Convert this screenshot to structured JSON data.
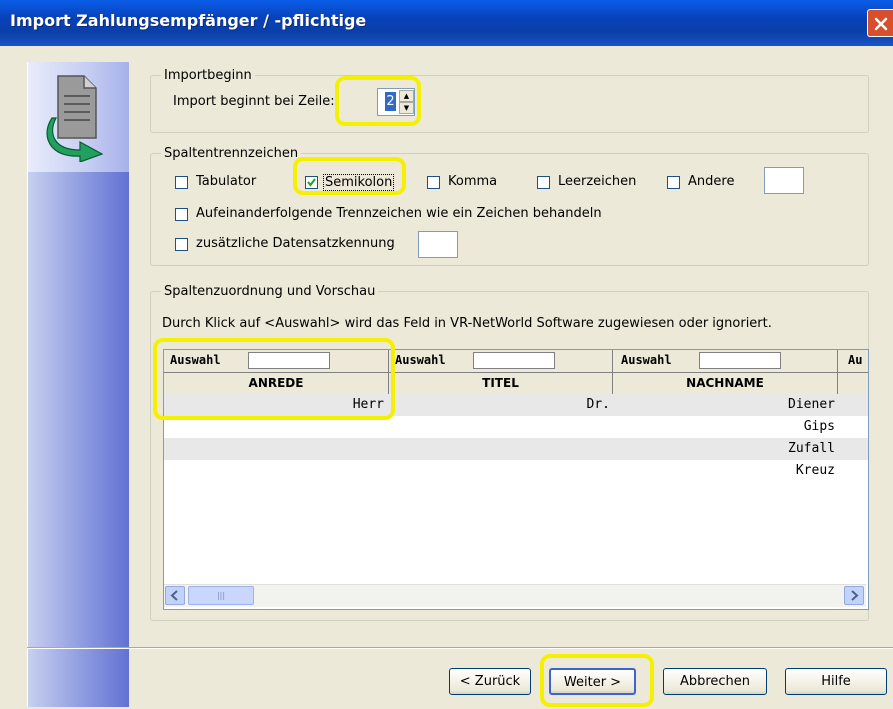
{
  "window": {
    "title": "Import Zahlungsempfänger / -pflichtige"
  },
  "import_start": {
    "group_title": "Importbeginn",
    "label": "Import beginnt bei Zeile:",
    "value": "2"
  },
  "delimiters": {
    "group_title": "Spaltentrennzeichen",
    "tabulator": {
      "label": "Tabulator",
      "checked": false
    },
    "semikolon": {
      "label": "Semikolon",
      "checked": true
    },
    "komma": {
      "label": "Komma",
      "checked": false
    },
    "leerzeichen": {
      "label": "Leerzeichen",
      "checked": false
    },
    "andere": {
      "label": "Andere",
      "checked": false,
      "value": ""
    },
    "consecutive": {
      "label": "Aufeinanderfolgende Trennzeichen wie ein Zeichen behandeln",
      "checked": false
    },
    "record_id": {
      "label": "zusätzliche Datensatzkennung",
      "checked": false,
      "value": ""
    }
  },
  "mapping": {
    "group_title": "Spaltenzuordnung und Vorschau",
    "instruction": "Durch Klick auf <Auswahl> wird das Feld in VR-NetWorld Software zugewiesen oder ignoriert.",
    "select_label": "Auswahl",
    "select_label_partial": "Au",
    "columns": [
      "ANREDE",
      "TITEL",
      "NACHNAME"
    ],
    "rows": [
      [
        "Herr",
        "Dr.",
        "Diener"
      ],
      [
        "",
        "",
        "Gips"
      ],
      [
        "",
        "",
        "Zufall"
      ],
      [
        "",
        "",
        "Kreuz"
      ]
    ]
  },
  "buttons": {
    "back": "< Zurück",
    "next": "Weiter >",
    "cancel": "Abbrechen",
    "help": "Hilfe"
  },
  "colors": {
    "highlight": "#f5f000",
    "titlebar": "#0841b8"
  }
}
